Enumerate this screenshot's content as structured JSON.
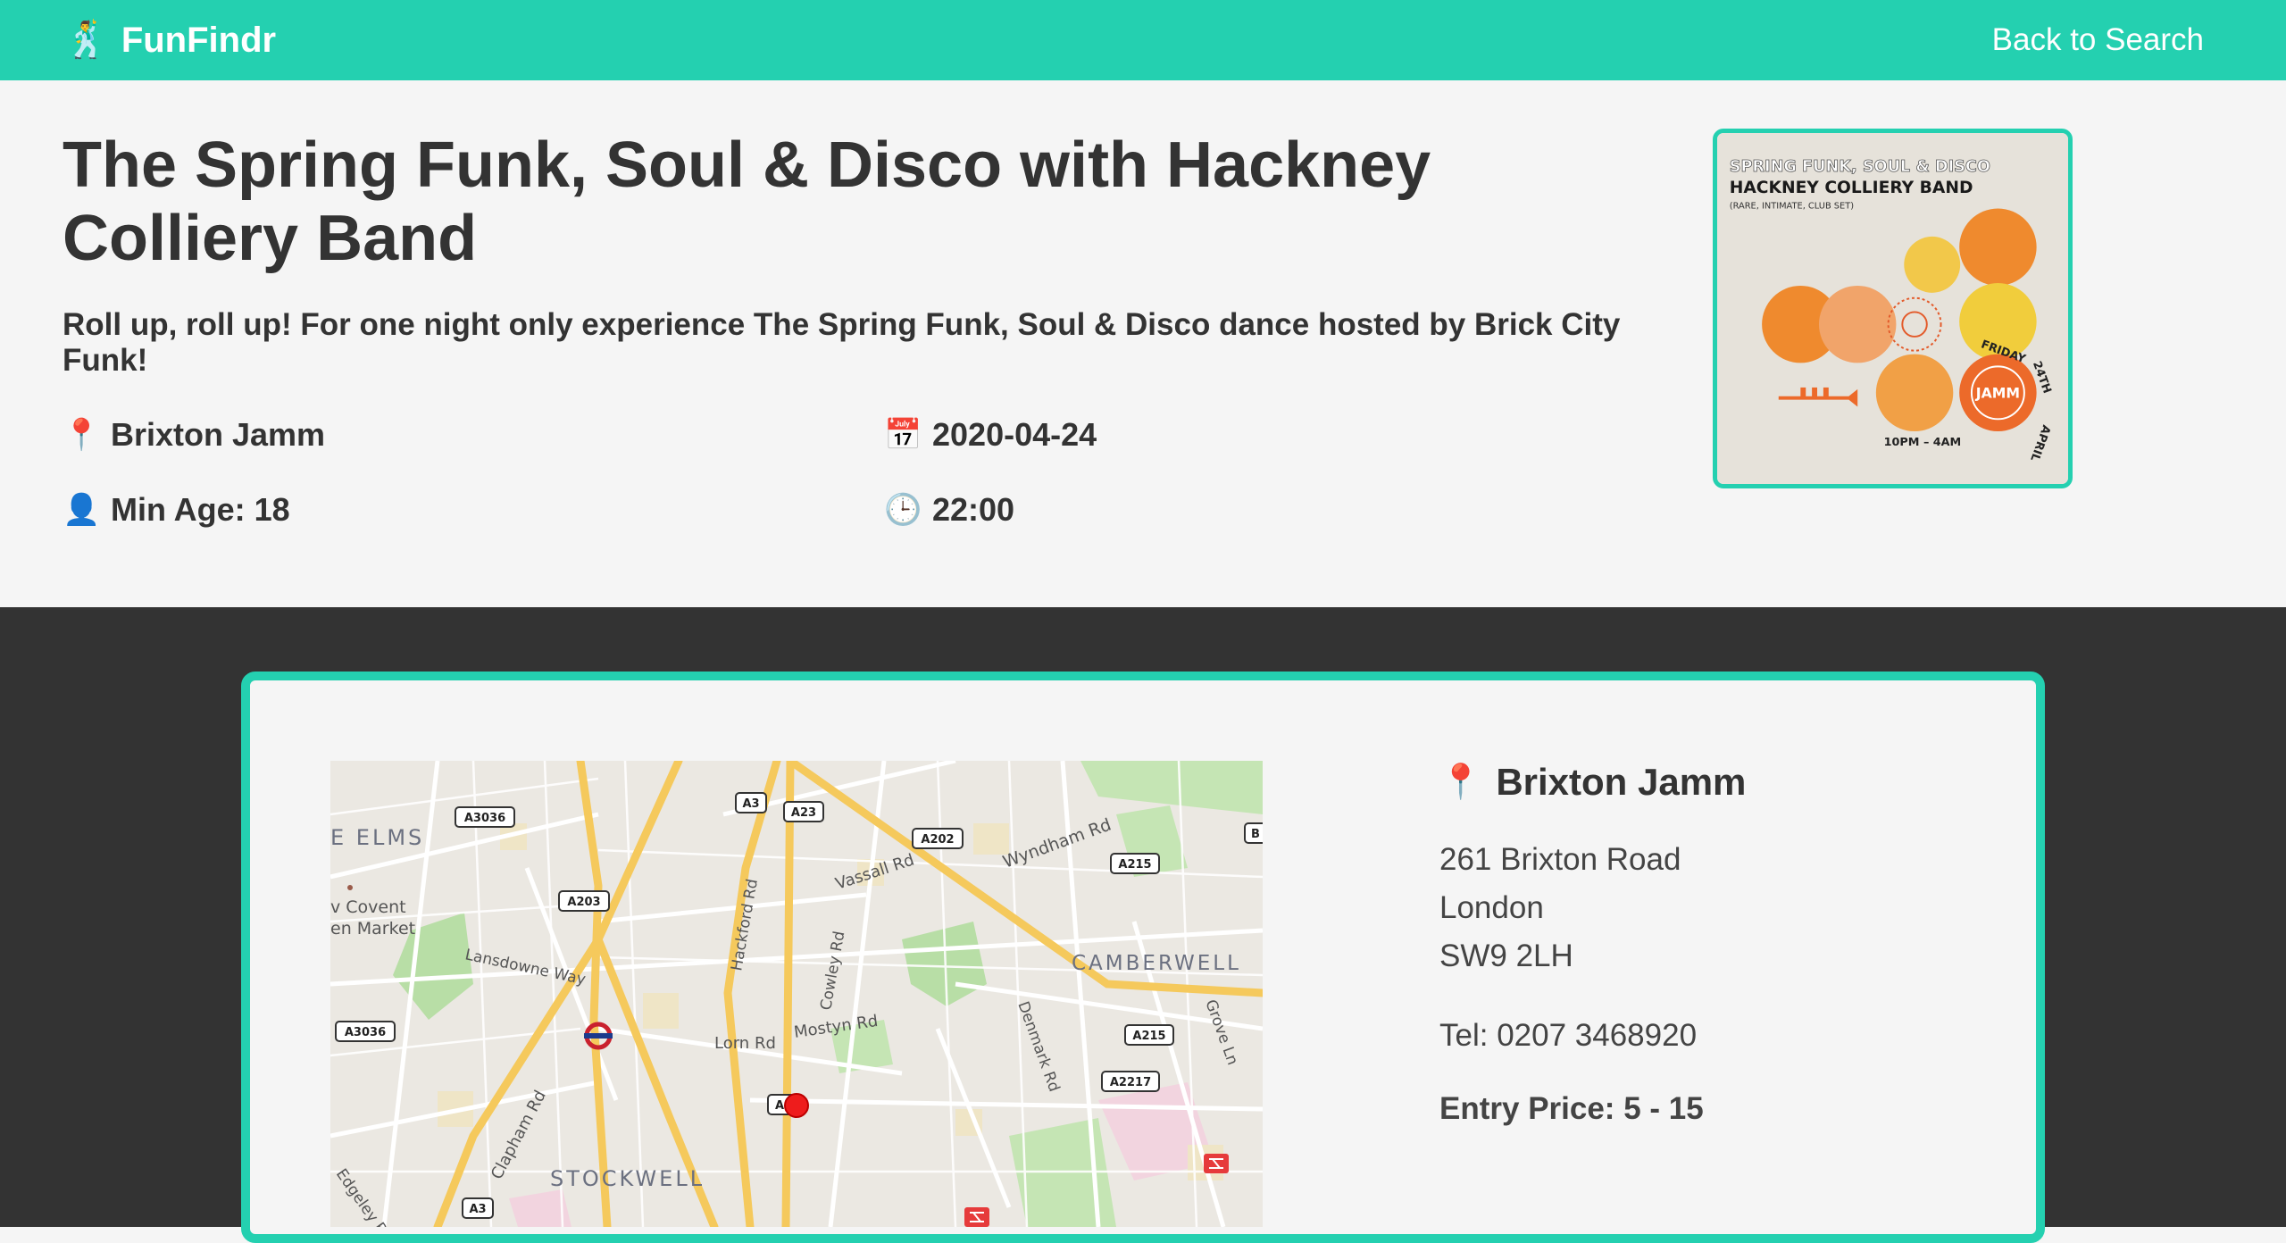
{
  "nav": {
    "brand": "FunFindr",
    "brand_icon": "🕺",
    "back_link": "Back to Search",
    "accent_color": "#24d0b0"
  },
  "event": {
    "title": "The Spring Funk, Soul & Disco with Hackney Colliery Band",
    "description": "Roll up, roll up! For one night only experience The Spring Funk, Soul & Disco dance hosted by Brick City Funk!",
    "location": "Brixton Jamm",
    "date": "2020-04-24",
    "min_age": "Min Age: 18",
    "time": "22:00",
    "icons": {
      "location": "📍",
      "date": "📅",
      "age": "👤",
      "time": "🕒"
    }
  },
  "poster": {
    "line1": "SPRING FUNK, SOUL & DISCO",
    "line2": "HACKNEY COLLIERY BAND",
    "line3": "(RARE, INTIMATE, CLUB SET)",
    "day": "FRIDAY",
    "date": "24TH",
    "month": "APRIL",
    "venue": "JAMM",
    "hours": "10PM – 4AM"
  },
  "venue": {
    "pin_icon": "📍",
    "name": "Brixton Jamm",
    "address_line1": "261 Brixton Road",
    "address_line2": "London",
    "address_line3": "SW9 2LH",
    "tel": "Tel: 0207 3468920",
    "entry_price": "Entry Price: 5 - 15"
  },
  "map": {
    "labels": {
      "elms": "E ELMS",
      "covent1": "v Covent",
      "covent2": "en Market",
      "lansdowne": "Lansdowne Way",
      "hackford": "Hackford Rd",
      "cowley": "Cowley Rd",
      "vassall": "Vassall Rd",
      "wyndham": "Wyndham Rd",
      "camberwell": "CAMBERWELL",
      "lorn": "Lorn Rd",
      "mostyn": "Mostyn Rd",
      "denmark": "Denmark Rd",
      "grove": "Grove Ln",
      "clapham": "Clapham Rd",
      "stockwell": "STOCKWELL",
      "edgeley": "Edgeley R"
    },
    "shields": {
      "a3036_top": "A3036",
      "a3": "A3",
      "a23": "A23",
      "a202": "A202",
      "a215_top": "A215",
      "b": "B",
      "a203": "A203",
      "a3036_left": "A3036",
      "a215_mid": "A215",
      "a2217": "A2217",
      "a_marker": "A",
      "a3_bottom": "A3"
    }
  }
}
